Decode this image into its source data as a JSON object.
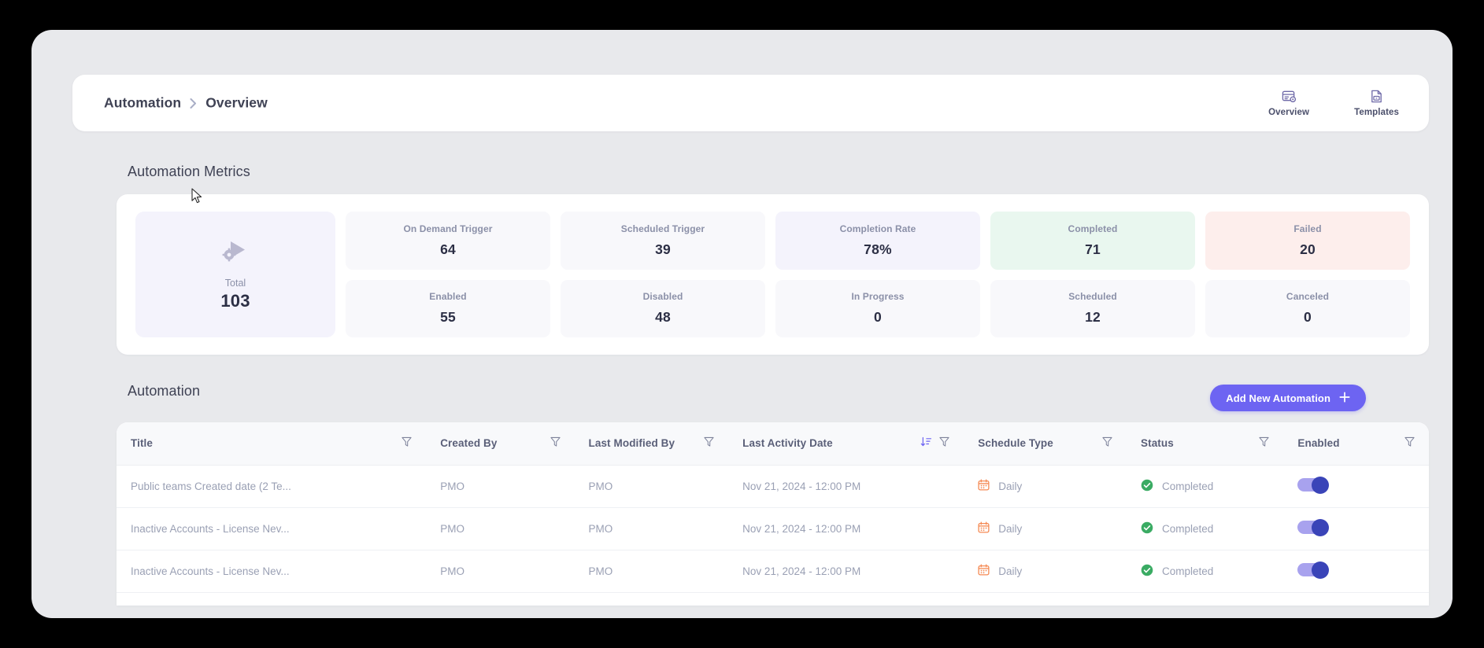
{
  "header": {
    "breadcrumb_root": "Automation",
    "breadcrumb_separator": "›",
    "breadcrumb_current": "Overview",
    "nav": [
      {
        "label": "Overview",
        "icon": "overview-icon"
      },
      {
        "label": "Templates",
        "icon": "templates-icon"
      }
    ]
  },
  "metrics": {
    "section_title": "Automation Metrics",
    "total": {
      "label": "Total",
      "value": "103",
      "icon": "automation-play-gear-icon"
    },
    "tiles": [
      {
        "label": "On Demand Trigger",
        "value": "64",
        "tint": ""
      },
      {
        "label": "Scheduled Trigger",
        "value": "39",
        "tint": ""
      },
      {
        "label": "Completion Rate",
        "value": "78%",
        "tint": "tint-purple"
      },
      {
        "label": "Completed",
        "value": "71",
        "tint": "tint-green"
      },
      {
        "label": "Failed",
        "value": "20",
        "tint": "tint-red"
      },
      {
        "label": "Enabled",
        "value": "55",
        "tint": ""
      },
      {
        "label": "Disabled",
        "value": "48",
        "tint": ""
      },
      {
        "label": "In Progress",
        "value": "0",
        "tint": ""
      },
      {
        "label": "Scheduled",
        "value": "12",
        "tint": ""
      },
      {
        "label": "Canceled",
        "value": "0",
        "tint": ""
      }
    ]
  },
  "automation": {
    "section_title": "Automation",
    "add_button_label": "Add New Automation",
    "columns": [
      {
        "label": "Title",
        "filter": true,
        "sort": false
      },
      {
        "label": "Created By",
        "filter": true,
        "sort": false
      },
      {
        "label": "Last Modified By",
        "filter": true,
        "sort": false
      },
      {
        "label": "Last Activity Date",
        "filter": true,
        "sort": true
      },
      {
        "label": "Schedule Type",
        "filter": true,
        "sort": false
      },
      {
        "label": "Status",
        "filter": true,
        "sort": false
      },
      {
        "label": "Enabled",
        "filter": true,
        "sort": false
      }
    ],
    "rows": [
      {
        "title": "Public teams Created date (2 Te...",
        "created_by": "PMO",
        "last_modified_by": "PMO",
        "last_activity_date": "Nov 21, 2024 - 12:00 PM",
        "schedule_type": "Daily",
        "status": "Completed",
        "enabled": "on"
      },
      {
        "title": "Inactive Accounts - License Nev...",
        "created_by": "PMO",
        "last_modified_by": "PMO",
        "last_activity_date": "Nov 21, 2024 - 12:00 PM",
        "schedule_type": "Daily",
        "status": "Completed",
        "enabled": "on"
      },
      {
        "title": "Inactive Accounts - License Nev...",
        "created_by": "PMO",
        "last_modified_by": "PMO",
        "last_activity_date": "Nov 21, 2024 - 12:00 PM",
        "schedule_type": "Daily",
        "status": "Completed",
        "enabled": "on"
      }
    ]
  },
  "colors": {
    "accent_purple": "#6d64f2",
    "toggle_knob": "#3a44b8",
    "status_green": "#3aab63",
    "calendar_orange": "#f58a54",
    "tint_green": "#e9f7ef",
    "tint_red": "#fdeeec",
    "tint_purple": "#f4f3fc",
    "page_bg": "#e8e9ec"
  }
}
